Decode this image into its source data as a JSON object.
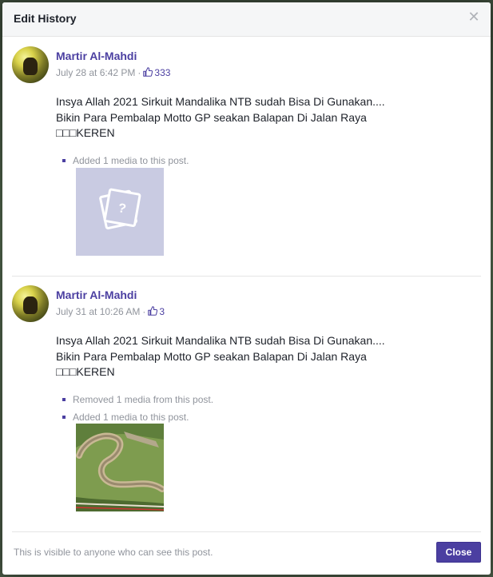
{
  "dialog": {
    "title": "Edit History",
    "close_icon": "close-icon",
    "footer_text": "This is visible to anyone who can see this post.",
    "close_label": "Close"
  },
  "entries": [
    {
      "author": "Martir Al-Mahdi",
      "timestamp": "July 28 at 6:42 PM",
      "separator": "·",
      "likes": "333",
      "text_lines": [
        "Insya Allah 2021 Sirkuit Mandalika NTB sudah Bisa Di Gunakan....",
        "Bikin Para Pembalap Motto GP seakan Balapan Di Jalan Raya",
        "□□□KEREN"
      ],
      "changes": [
        "Added 1 media to this post."
      ],
      "media": "missing-photo-placeholder"
    },
    {
      "author": "Martir Al-Mahdi",
      "timestamp": "July 31 at 10:26 AM",
      "separator": "·",
      "likes": "3",
      "text_lines": [
        "Insya Allah 2021 Sirkuit Mandalika NTB sudah Bisa Di Gunakan....",
        "Bikin Para Pembalap Motto GP seakan Balapan Di Jalan Raya",
        "□□□KEREN"
      ],
      "changes": [
        "Removed 1 media from this post.",
        "Added 1 media to this post."
      ],
      "media": "race-circuit-aerial-photo"
    }
  ],
  "colors": {
    "accent": "#4b3fa1",
    "muted_text": "#90949c",
    "placeholder": "#c9cbe2"
  }
}
